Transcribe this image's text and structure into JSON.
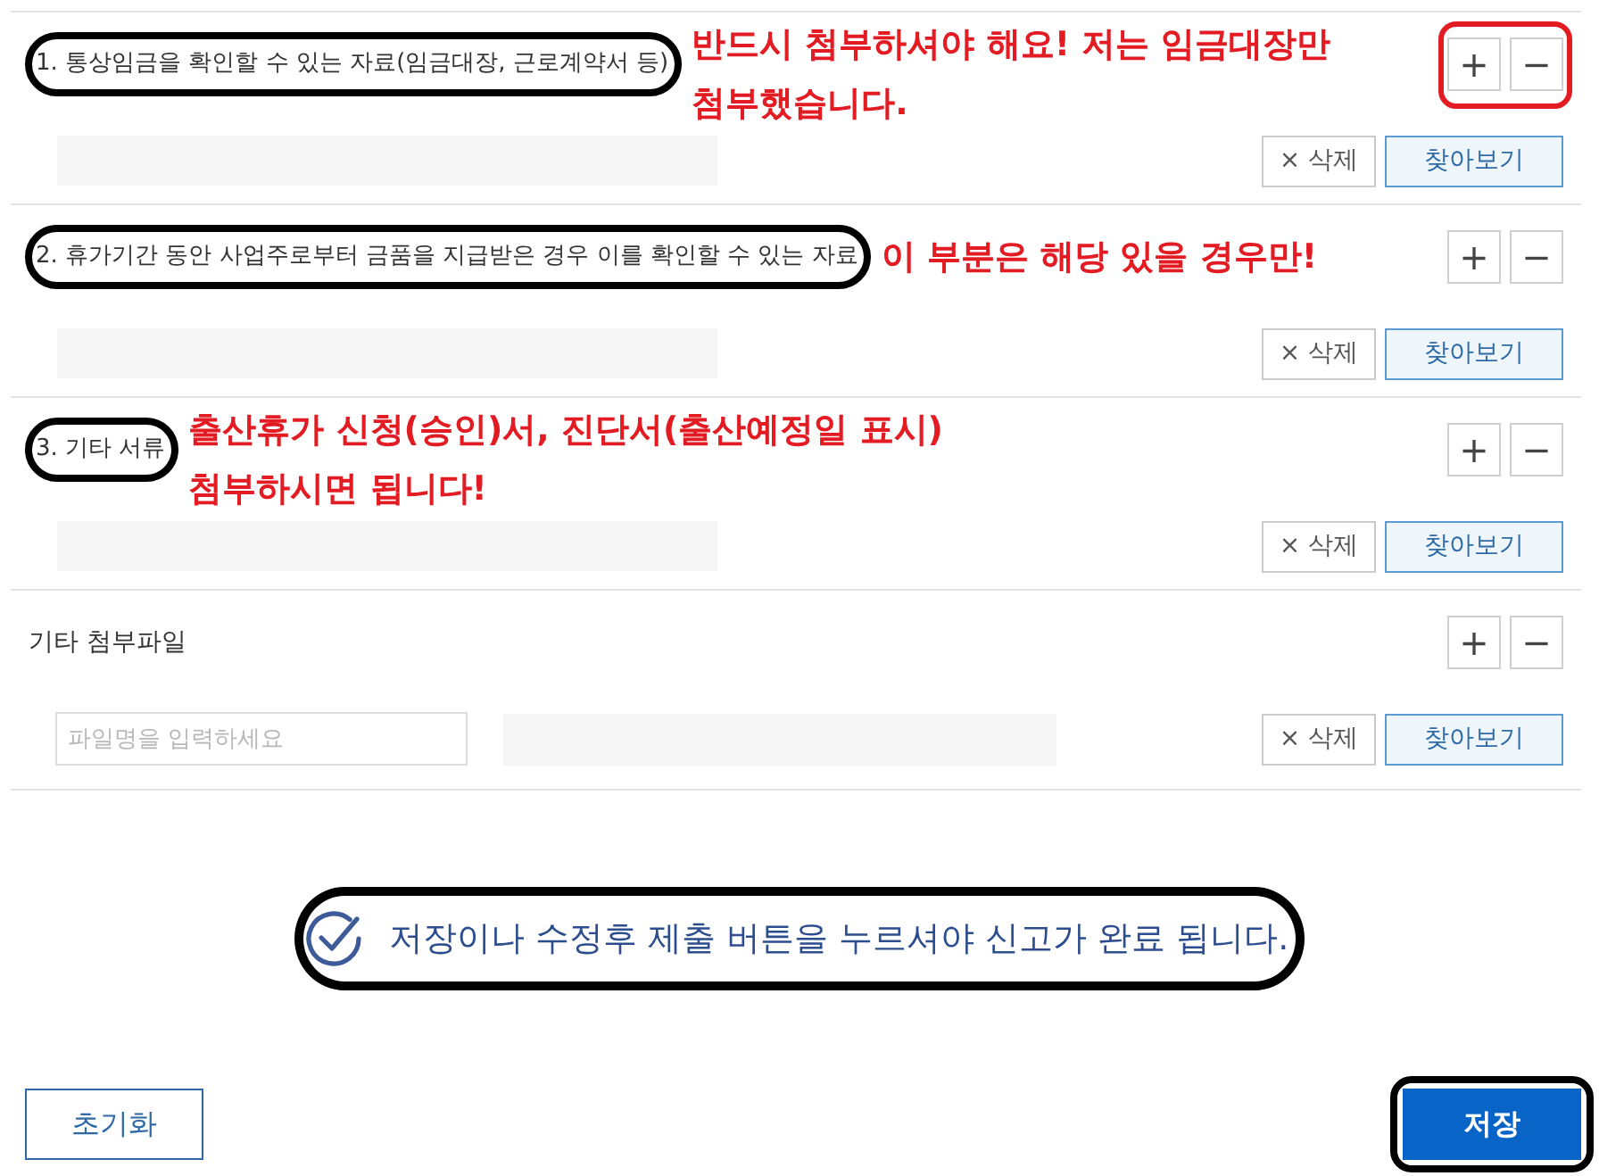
{
  "sections": [
    {
      "kind": "document",
      "title": "1. 통상임금을 확인할 수 있는 자료(임금대장, 근로계약서 등)",
      "title_circled": true,
      "note_lines": [
        "반드시 첨부하셔야 해요! 저는 임금대장만",
        "첨부했습니다."
      ],
      "stepper_circled": true,
      "add_label": "+",
      "remove_label": "−",
      "delete_label": "× 삭제",
      "browse_label": "찾아보기"
    },
    {
      "kind": "document",
      "title": "2. 휴가기간 동안 사업주로부터 금품을 지급받은 경우 이를 확인할 수 있는 자료",
      "title_circled": true,
      "note_lines": [
        "이 부분은 해당 있을 경우만!"
      ],
      "stepper_circled": false,
      "add_label": "+",
      "remove_label": "−",
      "delete_label": "× 삭제",
      "browse_label": "찾아보기"
    },
    {
      "kind": "document",
      "title": "3. 기타 서류",
      "title_circled": true,
      "note_lines": [
        "출산휴가 신청(승인)서, 진단서(출산예정일 표시)",
        "첨부하시면 됩니다!"
      ],
      "stepper_circled": false,
      "add_label": "+",
      "remove_label": "−",
      "delete_label": "× 삭제",
      "browse_label": "찾아보기"
    },
    {
      "kind": "extra",
      "title": "기타 첨부파일",
      "title_circled": false,
      "stepper_circled": false,
      "add_label": "+",
      "remove_label": "−",
      "name_placeholder": "파일명을 입력하세요",
      "delete_label": "× 삭제",
      "browse_label": "찾아보기"
    }
  ],
  "notice": {
    "text": "저장이나 수정후 제출 버튼을 누르셔야 신고가 완료 됩니다.",
    "circled": true
  },
  "buttons": [
    {
      "kind": "reset",
      "label": "초기화",
      "circled": false
    },
    {
      "kind": "save",
      "label": "저장",
      "circled": true
    }
  ]
}
